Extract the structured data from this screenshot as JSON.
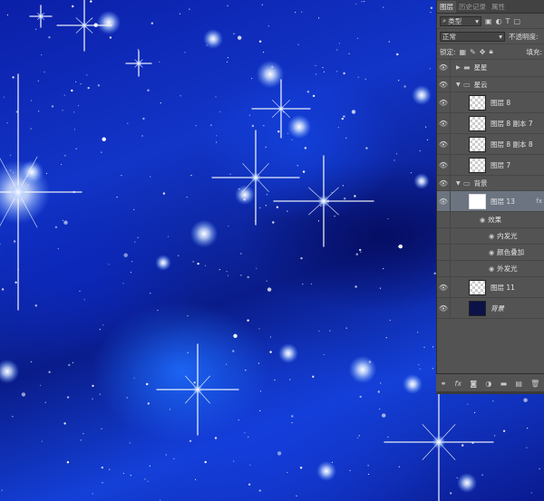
{
  "tabs": [
    "图层",
    "历史记录",
    "属性"
  ],
  "filter": {
    "kind_label": "类型"
  },
  "blend": {
    "mode": "正常",
    "opacity_label": "不透明度:"
  },
  "lock": {
    "label": "锁定:",
    "fill_label": "填充:"
  },
  "layers": [
    {
      "name": "星星",
      "type": "group",
      "expanded": false
    },
    {
      "name": "星云",
      "type": "group",
      "expanded": true
    },
    {
      "name": "图层 8",
      "type": "layer",
      "thumb": "transparent"
    },
    {
      "name": "图层 8 副本 7",
      "type": "layer",
      "thumb": "transparent"
    },
    {
      "name": "图层 8 副本 8",
      "type": "layer",
      "thumb": "transparent"
    },
    {
      "name": "图层 7",
      "type": "layer",
      "thumb": "transparent"
    },
    {
      "name": "背景",
      "type": "group",
      "expanded": true
    },
    {
      "name": "图层 13",
      "type": "layer",
      "thumb": "white",
      "selected": true
    },
    {
      "name": "效果",
      "type": "effects-header"
    },
    {
      "name": "内发光",
      "type": "effect"
    },
    {
      "name": "颜色叠加",
      "type": "effect"
    },
    {
      "name": "外发光",
      "type": "effect"
    },
    {
      "name": "图层 11",
      "type": "layer",
      "thumb": "transparent"
    },
    {
      "name": "背景",
      "type": "background",
      "thumb": "dark"
    }
  ],
  "footer_icons": [
    "link-icon",
    "fx-icon",
    "mask-icon",
    "adjustment-icon",
    "group-icon",
    "new-layer-icon",
    "trash-icon"
  ],
  "colors": {
    "panel": "#535353",
    "selected": "#6b7480",
    "canvas": "#1235c8"
  }
}
